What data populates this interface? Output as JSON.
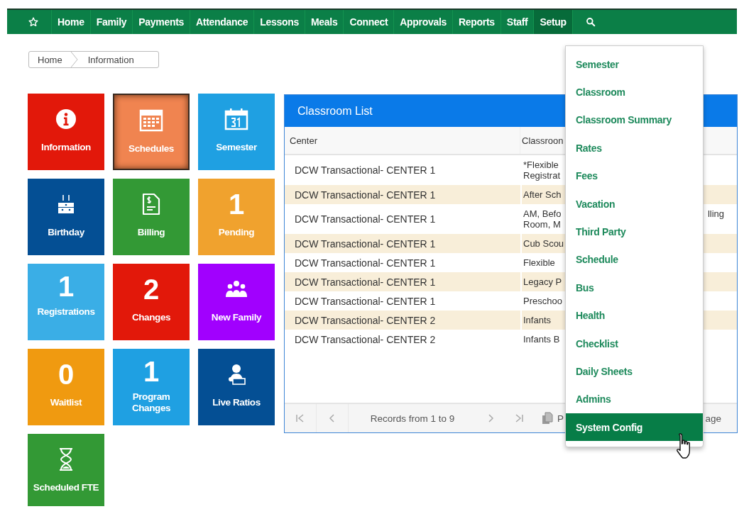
{
  "nav": {
    "items": [
      {
        "kind": "star",
        "selected": false
      },
      {
        "kind": "link",
        "label": "Home",
        "selected": false
      },
      {
        "kind": "link",
        "label": "Family",
        "selected": false
      },
      {
        "kind": "link",
        "label": "Payments",
        "selected": false
      },
      {
        "kind": "link",
        "label": "Attendance",
        "selected": false
      },
      {
        "kind": "link",
        "label": "Lessons",
        "selected": false
      },
      {
        "kind": "link",
        "label": "Meals",
        "selected": false
      },
      {
        "kind": "link",
        "label": "Connect",
        "selected": false
      },
      {
        "kind": "link",
        "label": "Approvals",
        "selected": false
      },
      {
        "kind": "link",
        "label": "Reports",
        "selected": false
      },
      {
        "kind": "link",
        "label": "Staff",
        "selected": false
      },
      {
        "kind": "link",
        "label": "Setup",
        "selected": true
      },
      {
        "kind": "search",
        "selected": false
      }
    ]
  },
  "breadcrumb": [
    "Home",
    "Information"
  ],
  "tiles": [
    {
      "label": "Information",
      "kind": "icon",
      "color": "#e2180a",
      "highlighted": false
    },
    {
      "label": "Schedules",
      "kind": "icon",
      "color": "#f08450",
      "highlighted": true
    },
    {
      "label": "Semester",
      "kind": "icon",
      "color": "#1fa0e2",
      "highlighted": false
    },
    {
      "label": "Birthday",
      "kind": "icon",
      "color": "#044f94",
      "highlighted": false
    },
    {
      "label": "Billing",
      "kind": "icon",
      "color": "#339935",
      "highlighted": false
    },
    {
      "label": "Pending",
      "kind": "count",
      "count": "1",
      "color": "#f0a22e",
      "highlighted": false
    },
    {
      "label": "Registrations",
      "kind": "count",
      "count": "1",
      "color": "#3aaee6",
      "highlighted": false
    },
    {
      "label": "Changes",
      "kind": "count",
      "count": "2",
      "color": "#e2180a",
      "highlighted": false
    },
    {
      "label": "New Family",
      "kind": "icon",
      "color": "#a100fe",
      "highlighted": false
    },
    {
      "label": "Waitlist",
      "kind": "count",
      "count": "0",
      "color": "#f09a10",
      "highlighted": false
    },
    {
      "label": "Program Changes",
      "kind": "count",
      "count": "1",
      "color": "#1fa0e2",
      "highlighted": false
    },
    {
      "label": "Live Ratios",
      "kind": "icon",
      "color": "#044f94",
      "highlighted": false
    },
    {
      "label": "Scheduled FTE",
      "kind": "icon",
      "color": "#339935",
      "highlighted": false
    }
  ],
  "panel": {
    "title": "Classroom List",
    "table": {
      "columns": [
        "Center",
        "Classroon"
      ],
      "rows": [
        {
          "center": "DCW Transactional- CENTER 1",
          "classroom": [
            "*Flexible",
            "Registrat"
          ]
        },
        {
          "center": "DCW Transactional- CENTER 1",
          "classroom": [
            "After Sch"
          ]
        },
        {
          "center": "DCW Transactional- CENTER 1",
          "classroom": [
            "AM, Befo",
            "Room, M"
          ],
          "right_fragment": "lling"
        },
        {
          "center": "DCW Transactional- CENTER 1",
          "classroom": [
            "Cub Scou"
          ]
        },
        {
          "center": "DCW Transactional- CENTER 1",
          "classroom": [
            "Flexible"
          ]
        },
        {
          "center": "DCW Transactional- CENTER 1",
          "classroom": [
            "Legacy P"
          ]
        },
        {
          "center": "DCW Transactional- CENTER 1",
          "classroom": [
            "Preschoo"
          ]
        },
        {
          "center": "DCW Transactional- CENTER 2",
          "classroom": [
            "Infants"
          ]
        },
        {
          "center": "DCW Transactional- CENTER 2",
          "classroom": [
            "Infants B"
          ]
        }
      ]
    },
    "pager": {
      "records": "Records from 1 to 9",
      "fragment_1": "P",
      "fragment_2": "age"
    }
  },
  "setup_menu": {
    "items": [
      {
        "label": "Semester",
        "selected": false
      },
      {
        "label": "Classroom",
        "selected": false
      },
      {
        "label": "Classroom Summary",
        "selected": false
      },
      {
        "label": "Rates",
        "selected": false
      },
      {
        "label": "Fees",
        "selected": false
      },
      {
        "label": "Vacation",
        "selected": false
      },
      {
        "label": "Third Party",
        "selected": false
      },
      {
        "label": "Schedule",
        "selected": false
      },
      {
        "label": "Bus",
        "selected": false
      },
      {
        "label": "Health",
        "selected": false
      },
      {
        "label": "Checklist",
        "selected": false
      },
      {
        "label": "Daily Sheets",
        "selected": false
      },
      {
        "label": "Admins",
        "selected": false
      },
      {
        "label": "System Config",
        "selected": true
      }
    ]
  }
}
